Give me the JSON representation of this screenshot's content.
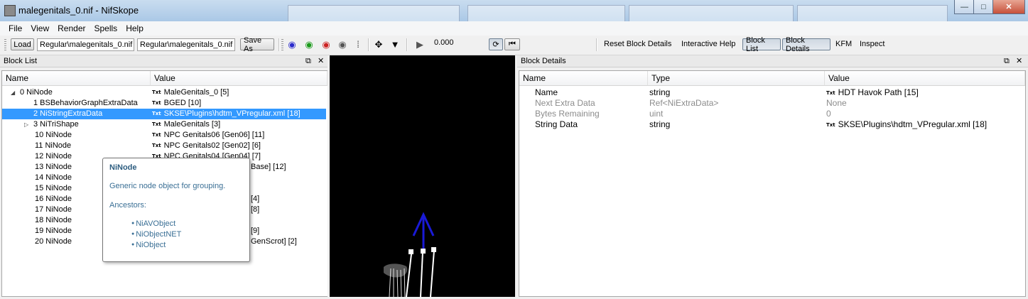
{
  "window": {
    "title": "malegenitals_0.nif - NifSkope",
    "controls": {
      "minimize": "—",
      "maximize": "□",
      "close": "✕"
    }
  },
  "menu": [
    {
      "label": "File"
    },
    {
      "label": "View"
    },
    {
      "label": "Render"
    },
    {
      "label": "Spells"
    },
    {
      "label": "Help"
    }
  ],
  "toolbar": {
    "load_label": "Load",
    "load_path": "Regular\\malegenitals_0.nif",
    "save_path": "Regular\\malegenitals_0.nif",
    "save_as_label": "Save As",
    "time_value": "0.000",
    "anim_select": "",
    "reset_block_details": "Reset Block Details",
    "interactive_help": "Interactive Help",
    "block_list": "Block List",
    "block_details": "Block Details",
    "kfm": "KFM",
    "inspect": "Inspect"
  },
  "block_list": {
    "title": "Block List",
    "col_name": "Name",
    "col_value": "Value",
    "rows": [
      {
        "name": "0 NiNode",
        "value": "MaleGenitals_0 [5]",
        "badge": "Txt",
        "expander": "◢"
      },
      {
        "name": "1 BSBehaviorGraphExtraData",
        "value": "BGED [10]",
        "badge": "Txt"
      },
      {
        "name": "2 NiStringExtraData",
        "value": "SKSE\\Plugins\\hdtm_VPregular.xml [18]",
        "badge": "Txt",
        "selected": true
      },
      {
        "name": "3 NiTriShape",
        "value": "MaleGenitals [3]",
        "badge": "Txt",
        "expander": "▷"
      },
      {
        "name": "10 NiNode",
        "value": "NPC Genitals06 [Gen06] [11]",
        "badge": "Txt"
      },
      {
        "name": "11 NiNode",
        "value": "NPC Genitals02 [Gen02] [6]",
        "badge": "Txt"
      },
      {
        "name": "12 NiNode",
        "value": "NPC Genitals04 [Gen04] [7]",
        "badge": "Txt"
      },
      {
        "name": "13 NiNode",
        "value": "Base] [12]",
        "badge": ""
      },
      {
        "name": "14 NiNode",
        "value": "",
        "badge": ""
      },
      {
        "name": "15 NiNode",
        "value": "",
        "badge": ""
      },
      {
        "name": "16 NiNode",
        "value": "[4]",
        "badge": ""
      },
      {
        "name": "17 NiNode",
        "value": "[8]",
        "badge": ""
      },
      {
        "name": "18 NiNode",
        "value": "",
        "badge": ""
      },
      {
        "name": "19 NiNode",
        "value": "[9]",
        "badge": ""
      },
      {
        "name": "20 NiNode",
        "value": "GenScrot] [2]",
        "badge": ""
      }
    ]
  },
  "tooltip": {
    "title": "NiNode",
    "description": "Generic node object for grouping.",
    "ancestors_label": "Ancestors:",
    "ancestors": [
      "NiAVObject",
      "NiObjectNET",
      "NiObject"
    ]
  },
  "block_details": {
    "title": "Block Details",
    "col_name": "Name",
    "col_type": "Type",
    "col_value": "Value",
    "rows": [
      {
        "name": "Name",
        "type": "string",
        "value": "HDT Havok Path [15]",
        "badge": "Txt",
        "disabled": false
      },
      {
        "name": "Next Extra Data",
        "type": "Ref<NiExtraData>",
        "value": "None",
        "badge": "",
        "disabled": true
      },
      {
        "name": "Bytes Remaining",
        "type": "uint",
        "value": "0",
        "badge": "",
        "disabled": true
      },
      {
        "name": "String Data",
        "type": "string",
        "value": "SKSE\\Plugins\\hdtm_VPregular.xml [18]",
        "badge": "Txt",
        "disabled": false
      }
    ]
  },
  "dock_controls": {
    "float": "⧉",
    "close": "✕"
  },
  "colors": {
    "selection": "#3399ff",
    "axis": "#1a1ad6",
    "viewport_bg": "#000000"
  }
}
